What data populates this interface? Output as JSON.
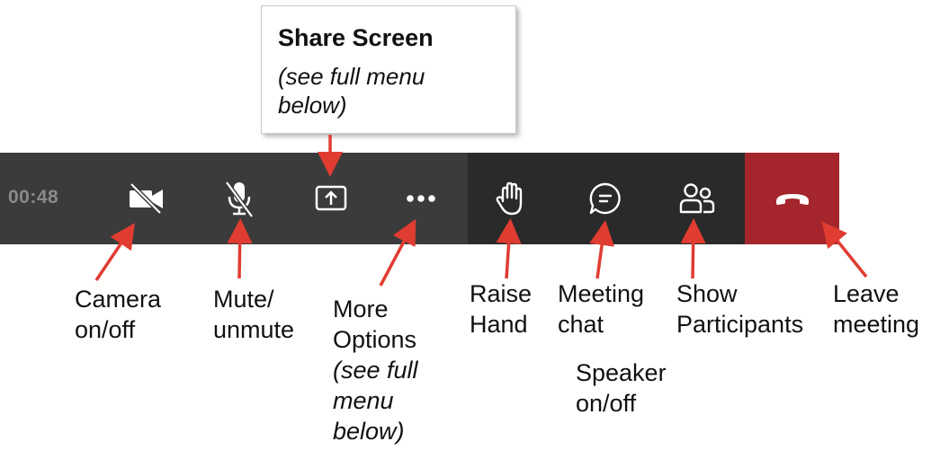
{
  "callout": {
    "title": "Share Screen",
    "subtitle": "(see full menu\nbelow)"
  },
  "toolbar": {
    "timer": "00:48",
    "buttons": [
      {
        "icon": "camera-off-icon"
      },
      {
        "icon": "mic-off-icon"
      },
      {
        "icon": "share-screen-icon"
      },
      {
        "icon": "more-options-icon"
      },
      {
        "icon": "raise-hand-icon"
      },
      {
        "icon": "chat-icon"
      },
      {
        "icon": "participants-icon"
      },
      {
        "icon": "leave-phone-icon"
      }
    ],
    "colors": {
      "bar": "#3b3b3b",
      "bar_dark": "#2a2a2a",
      "leave": "#a4262c",
      "icon": "#ffffff"
    }
  },
  "labels": {
    "camera": "Camera\non/off",
    "mute": "Mute/\nunmute",
    "more_options": "More\nOptions",
    "more_options_note": "(see full\nmenu\nbelow)",
    "raise_hand": "Raise\nHand",
    "meeting_chat": "Meeting\nchat",
    "speaker": "Speaker\non/off",
    "show_participants": "Show\nParticipants",
    "leave_meeting": "Leave\nmeeting"
  },
  "arrow_color": "#e03c31"
}
